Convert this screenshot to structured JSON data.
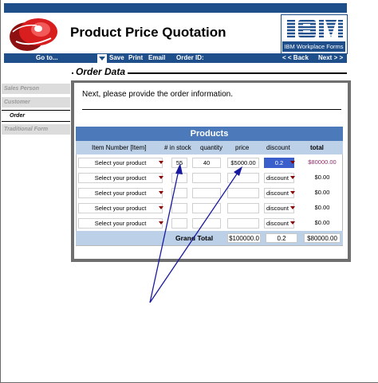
{
  "header": {
    "title": "Product Price Quotation",
    "brand": {
      "logo_text": "IBM",
      "caption": "IBM Workplace Forms"
    },
    "logo_icon": "red-sphere-logo"
  },
  "navbar": {
    "goto_label": "Go to...",
    "actions": [
      "Save",
      "Print",
      "Email"
    ],
    "order_id_label": "Order ID:",
    "back_label": "< < Back",
    "next_label": "Next > >"
  },
  "section": {
    "title": "Order Data"
  },
  "sidebar": {
    "items": [
      {
        "label": "Sales Person"
      },
      {
        "label": "Customer"
      },
      {
        "label": "Order"
      },
      {
        "label": "Traditional Form"
      }
    ]
  },
  "main": {
    "instruction": "Next, please provide the order information."
  },
  "products": {
    "title": "Products",
    "columns": [
      "Item Number [Item]",
      "# in stock",
      "quantity",
      "price",
      "discount",
      "total"
    ],
    "rows": [
      {
        "product": "Select your product",
        "stock": "55",
        "quantity": "40",
        "price": "$5000.00",
        "discount": "0.2",
        "total": "$80000.00"
      },
      {
        "product": "Select your product",
        "stock": "",
        "quantity": "",
        "price": "",
        "discount": "discount",
        "total": "$0.00"
      },
      {
        "product": "Select your product",
        "stock": "",
        "quantity": "",
        "price": "",
        "discount": "discount",
        "total": "$0.00"
      },
      {
        "product": "Select your product",
        "stock": "",
        "quantity": "",
        "price": "",
        "discount": "discount",
        "total": "$0.00"
      },
      {
        "product": "Select your product",
        "stock": "",
        "quantity": "",
        "price": "",
        "discount": "discount",
        "total": "$0.00"
      }
    ],
    "grand_total": {
      "label": "Grand Total",
      "price": "$100000.0",
      "discount": "0.2",
      "total": "$80000.00"
    }
  },
  "colors": {
    "brand_blue": "#1f4f8b",
    "table_header": "#4b79b9",
    "table_sub": "#bcd0e8",
    "arrow": "#1a1aa0",
    "total_highlight": "#8b2d6a"
  }
}
